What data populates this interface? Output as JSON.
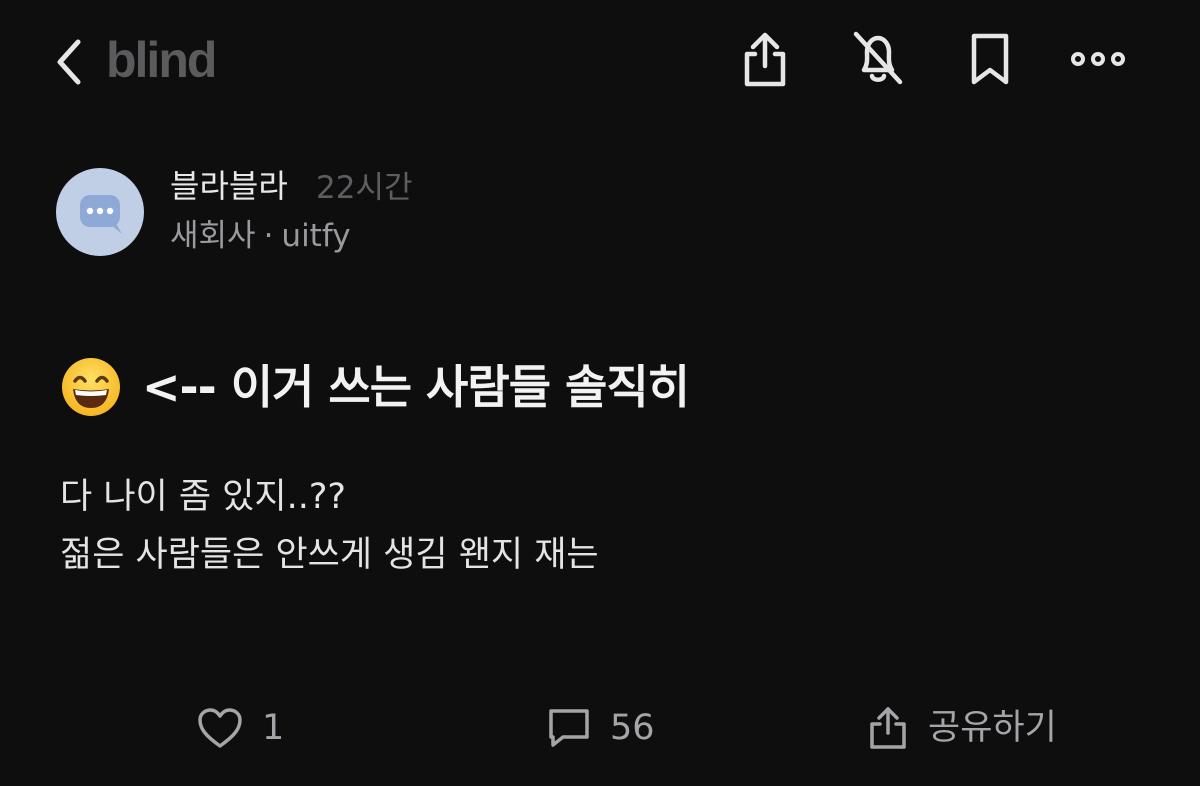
{
  "header": {
    "logo_text": "blind",
    "icons": [
      "chevron-left-icon",
      "share-icon",
      "bell-off-icon",
      "bookmark-icon",
      "more-icon"
    ]
  },
  "author": {
    "name": "블라블라",
    "time": "22시간",
    "company": "새회사",
    "separator": "·",
    "handle": "uitfy",
    "avatar_icon": "chat-bubble-icon",
    "avatar_color": "#c0cfe6"
  },
  "post": {
    "title_emoji": "grinning-face-emoji",
    "title": "<-- 이거 쓰는 사람들 솔직히",
    "body_lines": [
      "다 나이 좀 있지..??",
      "젊은 사람들은 안쓰게 생김 왠지 재는"
    ]
  },
  "actions": {
    "like_count": "1",
    "comment_count": "56",
    "share_label": "공유하기"
  },
  "colors": {
    "background": "#0e0e0f",
    "logo": "#5b5b5e",
    "muted_text": "#9a9a9e",
    "icon": "#e6e6e6"
  }
}
